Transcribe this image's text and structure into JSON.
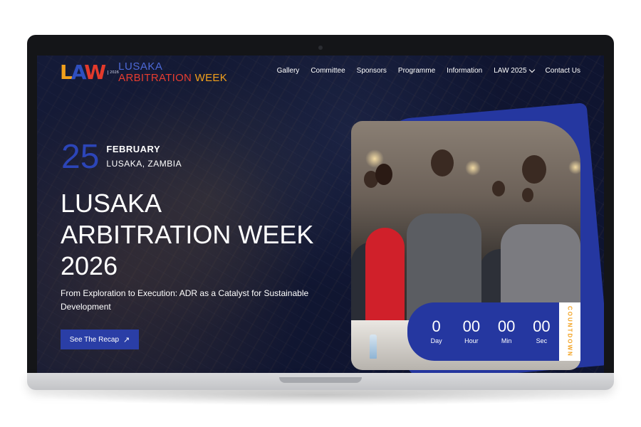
{
  "header": {
    "logo": {
      "mark_l": "L",
      "mark_a": "A",
      "mark_w": "W",
      "year": "2026",
      "line1": "LUSAKA",
      "line2_a": "ARBITRATION",
      "line2_b": " WEEK"
    },
    "nav": [
      {
        "label": "Gallery"
      },
      {
        "label": "Committee"
      },
      {
        "label": "Sponsors"
      },
      {
        "label": "Programme"
      },
      {
        "label": "Information"
      },
      {
        "label": "LAW 2025",
        "has_dropdown": true
      },
      {
        "label": "Contact Us"
      }
    ]
  },
  "hero": {
    "day": "25",
    "month": "FEBRUARY",
    "place": "LUSAKA, ZAMBIA",
    "title_lines": [
      "LUSAKA",
      "ARBITRATION WEEK",
      "2026"
    ],
    "subtitle": "From Exploration to Execution: ADR as a Catalyst for Sustainable Development",
    "cta_label": "See The Recap",
    "cta_icon": "arrow-up-right-icon"
  },
  "countdown": {
    "units": [
      {
        "value": "0",
        "label": "Day"
      },
      {
        "value": "00",
        "label": "Hour"
      },
      {
        "value": "00",
        "label": "Min"
      },
      {
        "value": "00",
        "label": "Sec"
      }
    ],
    "tab_label": "COUNTDOWN"
  },
  "colors": {
    "brand_blue": "#2a3ea6",
    "brand_orange": "#f2a01c",
    "brand_red": "#e33a2b"
  }
}
